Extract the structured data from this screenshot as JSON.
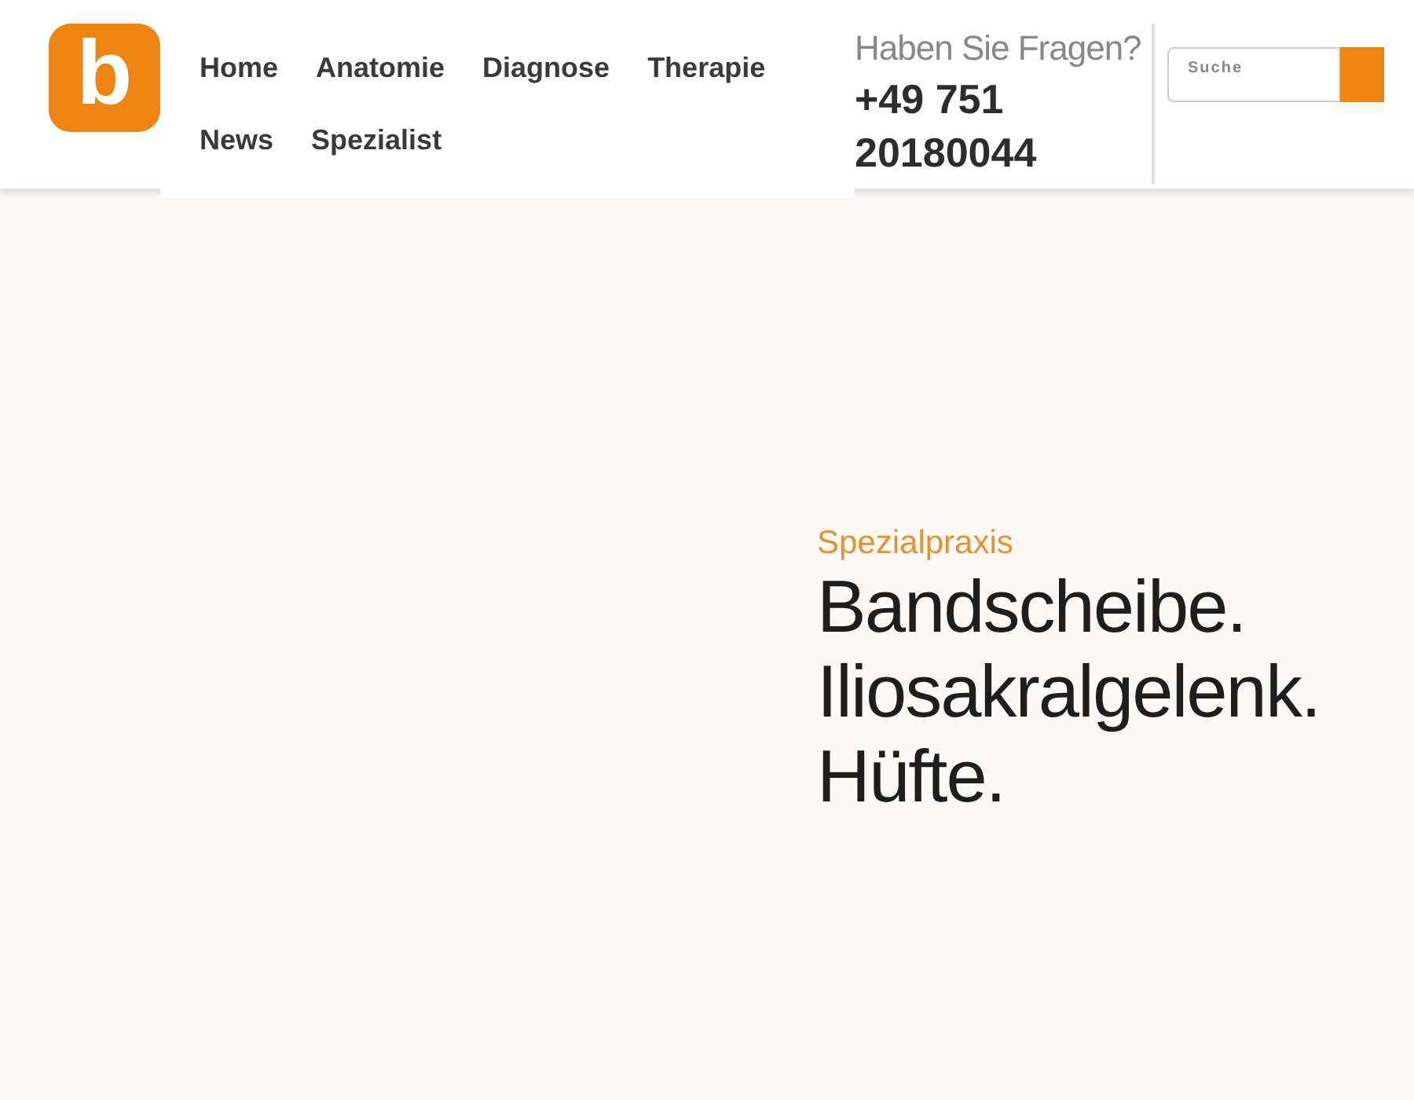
{
  "logo": {
    "letter": "b"
  },
  "nav": {
    "items": [
      {
        "label": "Home"
      },
      {
        "label": "Anatomie"
      },
      {
        "label": "Diagnose"
      },
      {
        "label": "Therapie"
      },
      {
        "label": "News"
      },
      {
        "label": "Spezialist"
      }
    ]
  },
  "contact": {
    "question": "Haben Sie Fragen?",
    "phone_lines": [
      "+49 751",
      "20180044"
    ]
  },
  "search": {
    "placeholder": "Suche"
  },
  "hero": {
    "eyebrow": "Spezialpraxis",
    "headline_lines": [
      "Bandscheibe.",
      "Iliosakralgelenk.",
      "Hüfte."
    ]
  }
}
